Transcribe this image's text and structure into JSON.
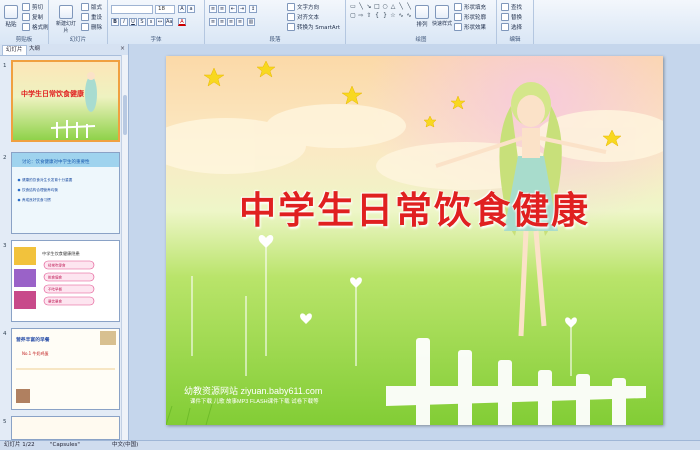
{
  "ribbon": {
    "clipboard": {
      "label": "剪贴板",
      "paste": "粘贴",
      "cut": "剪切",
      "copy": "复制",
      "format_painter": "格式刷"
    },
    "slides": {
      "label": "幻灯片",
      "new_slide": "新建幻灯片",
      "layout": "版式",
      "reset": "重设",
      "delete": "删除"
    },
    "font": {
      "label": "字体",
      "font_name": "",
      "font_size": "18"
    },
    "paragraph": {
      "label": "段落",
      "text_direction": "文字方向",
      "align_text": "对齐文本",
      "smartart": "转换为 SmartArt"
    },
    "drawing": {
      "label": "绘图",
      "arrange": "排列",
      "quick_styles": "快速样式",
      "shape_fill": "形状填充",
      "shape_outline": "形状轮廓",
      "shape_effects": "形状效果"
    },
    "editing": {
      "label": "编辑",
      "find": "查找",
      "replace": "替换",
      "select": "选择"
    }
  },
  "panel": {
    "tabs": [
      "幻灯片",
      "大纲"
    ],
    "slides": [
      {
        "num": "1",
        "title": "中学生日常饮食健康"
      },
      {
        "num": "2",
        "title": "讨论：饮食健康对中学生的重要性",
        "items": [
          "健康的饮食对生长发育十分重要",
          "饮食结构合理营养均衡",
          "养成良好饮食习惯"
        ]
      },
      {
        "num": "3",
        "title": "中学生饮食健康隐患",
        "items": [
          "经常吃零食",
          "挑食偏食",
          "不吃早餐",
          "暴饮暴食"
        ]
      },
      {
        "num": "4",
        "title": "营养丰富的早餐",
        "sub": "No.1 牛奶鸡蛋"
      }
    ]
  },
  "slide": {
    "title": "中学生日常饮食健康",
    "footer_site": "幼教资源网站  ziyuan.baby611.com",
    "footer_links": "课件下载  儿歌  故事MP3  FLASH课件下载  试卷下载等"
  },
  "status": {
    "slide_info": "幻灯片 1/22",
    "theme": "\"Capsules\"",
    "language": "中文(中国)"
  },
  "colors": {
    "title_red": "#e02020",
    "ribbon_bg": "#dbe7f6",
    "selection": "#f0a040"
  }
}
